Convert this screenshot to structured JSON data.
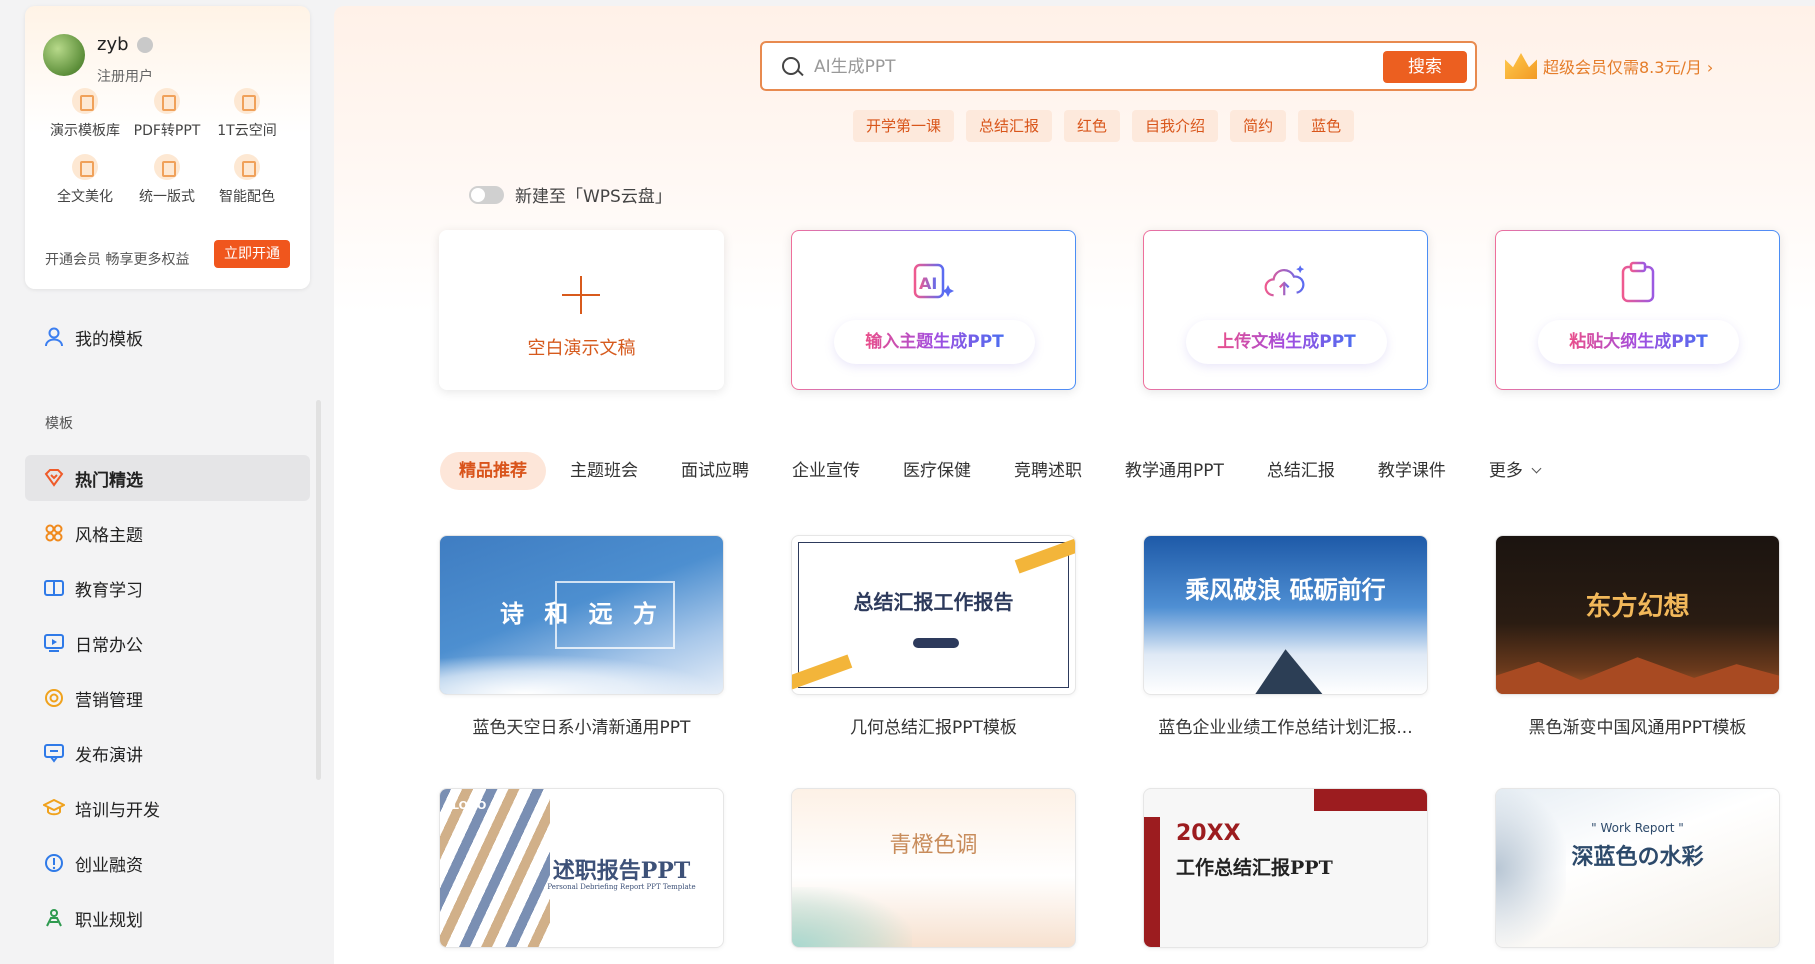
{
  "user": {
    "name": "zyb",
    "role": "注册用户",
    "tools": [
      {
        "label": "演示模板库",
        "icon": "template-icon"
      },
      {
        "label": "PDF转PPT",
        "icon": "pdf-convert-icon"
      },
      {
        "label": "1T云空间",
        "icon": "cloud-storage-icon"
      },
      {
        "label": "全文美化",
        "icon": "beautify-icon"
      },
      {
        "label": "统一版式",
        "icon": "layout-icon"
      },
      {
        "label": "智能配色",
        "icon": "palette-icon"
      }
    ],
    "promo_text": "开通会员 畅享更多权益",
    "open_button": "立即开通"
  },
  "sidebar": {
    "my_templates": "我的模板",
    "section_label": "模板",
    "items": [
      {
        "label": "热门精选",
        "icon": "hot-icon"
      },
      {
        "label": "风格主题",
        "icon": "style-icon"
      },
      {
        "label": "教育学习",
        "icon": "book-icon"
      },
      {
        "label": "日常办公",
        "icon": "office-icon"
      },
      {
        "label": "营销管理",
        "icon": "marketing-icon"
      },
      {
        "label": "发布演讲",
        "icon": "speech-icon"
      },
      {
        "label": "培训与开发",
        "icon": "training-icon"
      },
      {
        "label": "创业融资",
        "icon": "funding-icon"
      },
      {
        "label": "职业规划",
        "icon": "career-icon"
      }
    ]
  },
  "search": {
    "placeholder": "AI生成PPT",
    "button": "搜索"
  },
  "vip_promo": "超级会员仅需8.3元/月 ›",
  "quick_tags": [
    "开学第一课",
    "总结汇报",
    "红色",
    "自我介绍",
    "简约",
    "蓝色"
  ],
  "cloud_toggle_label": "新建至「WPS云盘」",
  "create_cards": {
    "blank": "空白演示文稿",
    "topic": "输入主题生成PPT",
    "upload": "上传文档生成PPT",
    "outline": "粘贴大纲生成PPT"
  },
  "category_tabs": [
    "精品推荐",
    "主题班会",
    "面试应聘",
    "企业宣传",
    "医疗保健",
    "竞聘述职",
    "教学通用PPT",
    "总结汇报",
    "教学课件",
    "更多"
  ],
  "templates": [
    {
      "name": "蓝色天空日系小清新通用PPT",
      "thumb_text": "诗 和 远 方"
    },
    {
      "name": "几何总结汇报PPT模板",
      "thumb_text": "总结汇报工作报告"
    },
    {
      "name": "蓝色企业业绩工作总结计划汇报...",
      "thumb_text": "乘风破浪 砥砺前行"
    },
    {
      "name": "黑色渐变中国风通用PPT模板",
      "thumb_text": "东方幻想"
    },
    {
      "name": "",
      "thumb_text": "述职报告PPT",
      "thumb_sub": "Personal Debriefing Report PPT Template",
      "thumb_logo": "LOGO"
    },
    {
      "name": "",
      "thumb_text": "青橙色调"
    },
    {
      "name": "",
      "thumb_text": "工作总结汇报PPT",
      "thumb_sub": "20XX"
    },
    {
      "name": "",
      "thumb_text": "深蓝色の水彩",
      "thumb_sub": "\" Work Report \""
    }
  ]
}
